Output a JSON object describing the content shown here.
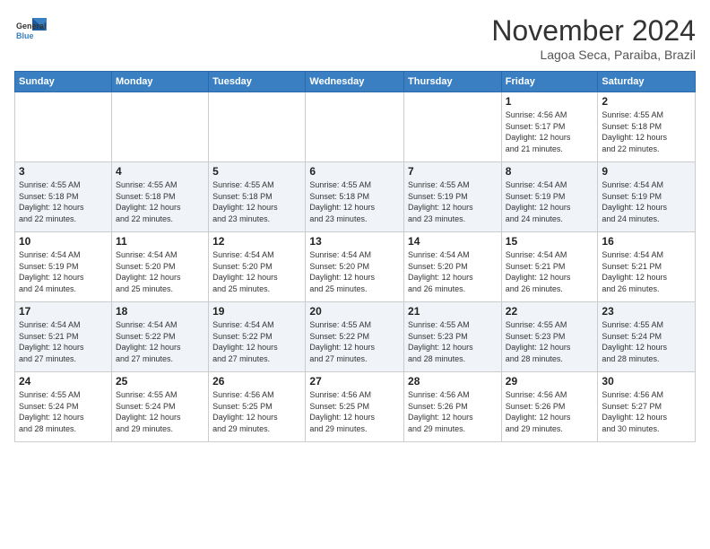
{
  "header": {
    "logo_line1": "General",
    "logo_line2": "Blue",
    "month": "November 2024",
    "location": "Lagoa Seca, Paraiba, Brazil"
  },
  "weekdays": [
    "Sunday",
    "Monday",
    "Tuesday",
    "Wednesday",
    "Thursday",
    "Friday",
    "Saturday"
  ],
  "weeks": [
    [
      {
        "day": "",
        "info": ""
      },
      {
        "day": "",
        "info": ""
      },
      {
        "day": "",
        "info": ""
      },
      {
        "day": "",
        "info": ""
      },
      {
        "day": "",
        "info": ""
      },
      {
        "day": "1",
        "info": "Sunrise: 4:56 AM\nSunset: 5:17 PM\nDaylight: 12 hours\nand 21 minutes."
      },
      {
        "day": "2",
        "info": "Sunrise: 4:55 AM\nSunset: 5:18 PM\nDaylight: 12 hours\nand 22 minutes."
      }
    ],
    [
      {
        "day": "3",
        "info": "Sunrise: 4:55 AM\nSunset: 5:18 PM\nDaylight: 12 hours\nand 22 minutes."
      },
      {
        "day": "4",
        "info": "Sunrise: 4:55 AM\nSunset: 5:18 PM\nDaylight: 12 hours\nand 22 minutes."
      },
      {
        "day": "5",
        "info": "Sunrise: 4:55 AM\nSunset: 5:18 PM\nDaylight: 12 hours\nand 23 minutes."
      },
      {
        "day": "6",
        "info": "Sunrise: 4:55 AM\nSunset: 5:18 PM\nDaylight: 12 hours\nand 23 minutes."
      },
      {
        "day": "7",
        "info": "Sunrise: 4:55 AM\nSunset: 5:19 PM\nDaylight: 12 hours\nand 23 minutes."
      },
      {
        "day": "8",
        "info": "Sunrise: 4:54 AM\nSunset: 5:19 PM\nDaylight: 12 hours\nand 24 minutes."
      },
      {
        "day": "9",
        "info": "Sunrise: 4:54 AM\nSunset: 5:19 PM\nDaylight: 12 hours\nand 24 minutes."
      }
    ],
    [
      {
        "day": "10",
        "info": "Sunrise: 4:54 AM\nSunset: 5:19 PM\nDaylight: 12 hours\nand 24 minutes."
      },
      {
        "day": "11",
        "info": "Sunrise: 4:54 AM\nSunset: 5:20 PM\nDaylight: 12 hours\nand 25 minutes."
      },
      {
        "day": "12",
        "info": "Sunrise: 4:54 AM\nSunset: 5:20 PM\nDaylight: 12 hours\nand 25 minutes."
      },
      {
        "day": "13",
        "info": "Sunrise: 4:54 AM\nSunset: 5:20 PM\nDaylight: 12 hours\nand 25 minutes."
      },
      {
        "day": "14",
        "info": "Sunrise: 4:54 AM\nSunset: 5:20 PM\nDaylight: 12 hours\nand 26 minutes."
      },
      {
        "day": "15",
        "info": "Sunrise: 4:54 AM\nSunset: 5:21 PM\nDaylight: 12 hours\nand 26 minutes."
      },
      {
        "day": "16",
        "info": "Sunrise: 4:54 AM\nSunset: 5:21 PM\nDaylight: 12 hours\nand 26 minutes."
      }
    ],
    [
      {
        "day": "17",
        "info": "Sunrise: 4:54 AM\nSunset: 5:21 PM\nDaylight: 12 hours\nand 27 minutes."
      },
      {
        "day": "18",
        "info": "Sunrise: 4:54 AM\nSunset: 5:22 PM\nDaylight: 12 hours\nand 27 minutes."
      },
      {
        "day": "19",
        "info": "Sunrise: 4:54 AM\nSunset: 5:22 PM\nDaylight: 12 hours\nand 27 minutes."
      },
      {
        "day": "20",
        "info": "Sunrise: 4:55 AM\nSunset: 5:22 PM\nDaylight: 12 hours\nand 27 minutes."
      },
      {
        "day": "21",
        "info": "Sunrise: 4:55 AM\nSunset: 5:23 PM\nDaylight: 12 hours\nand 28 minutes."
      },
      {
        "day": "22",
        "info": "Sunrise: 4:55 AM\nSunset: 5:23 PM\nDaylight: 12 hours\nand 28 minutes."
      },
      {
        "day": "23",
        "info": "Sunrise: 4:55 AM\nSunset: 5:24 PM\nDaylight: 12 hours\nand 28 minutes."
      }
    ],
    [
      {
        "day": "24",
        "info": "Sunrise: 4:55 AM\nSunset: 5:24 PM\nDaylight: 12 hours\nand 28 minutes."
      },
      {
        "day": "25",
        "info": "Sunrise: 4:55 AM\nSunset: 5:24 PM\nDaylight: 12 hours\nand 29 minutes."
      },
      {
        "day": "26",
        "info": "Sunrise: 4:56 AM\nSunset: 5:25 PM\nDaylight: 12 hours\nand 29 minutes."
      },
      {
        "day": "27",
        "info": "Sunrise: 4:56 AM\nSunset: 5:25 PM\nDaylight: 12 hours\nand 29 minutes."
      },
      {
        "day": "28",
        "info": "Sunrise: 4:56 AM\nSunset: 5:26 PM\nDaylight: 12 hours\nand 29 minutes."
      },
      {
        "day": "29",
        "info": "Sunrise: 4:56 AM\nSunset: 5:26 PM\nDaylight: 12 hours\nand 29 minutes."
      },
      {
        "day": "30",
        "info": "Sunrise: 4:56 AM\nSunset: 5:27 PM\nDaylight: 12 hours\nand 30 minutes."
      }
    ]
  ]
}
